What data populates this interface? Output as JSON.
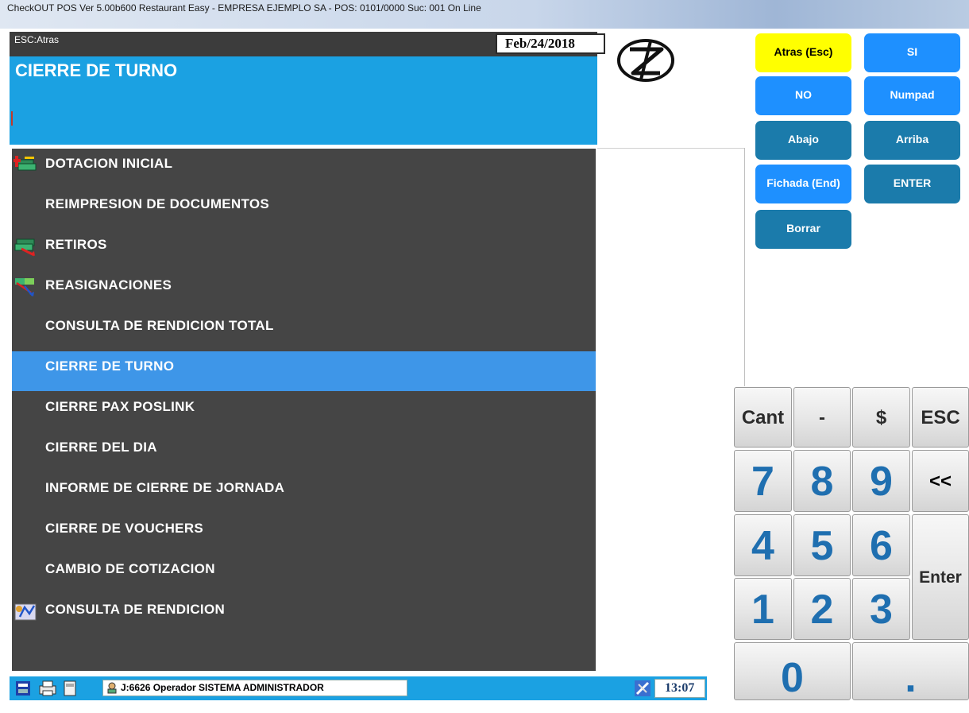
{
  "window": {
    "title": "CheckOUT POS Ver 5.00b600 Restaurant Easy - EMPRESA EJEMPLO SA - POS: 0101/0000 Suc: 001  On Line"
  },
  "header": {
    "esc_hint": "ESC:Atras",
    "date": "Feb/24/2018",
    "screen_title": "CIERRE DE TURNO"
  },
  "menu": {
    "items": [
      {
        "label": "DOTACION INICIAL",
        "icon": "cash-stack-icon"
      },
      {
        "label": "REIMPRESION DE DOCUMENTOS",
        "icon": ""
      },
      {
        "label": "RETIROS",
        "icon": "cash-withdraw-icon"
      },
      {
        "label": "REASIGNACIONES",
        "icon": "reassign-icon"
      },
      {
        "label": "CONSULTA DE RENDICION TOTAL",
        "icon": ""
      },
      {
        "label": "CIERRE DE TURNO",
        "icon": "",
        "selected": true
      },
      {
        "label": "CIERRE PAX POSLINK",
        "icon": ""
      },
      {
        "label": "CIERRE DEL DIA",
        "icon": ""
      },
      {
        "label": "INFORME DE CIERRE DE JORNADA",
        "icon": ""
      },
      {
        "label": "CIERRE DE VOUCHERS",
        "icon": ""
      },
      {
        "label": "CAMBIO DE COTIZACION",
        "icon": ""
      },
      {
        "label": "CONSULTA DE RENDICION",
        "icon": "report-icon"
      }
    ]
  },
  "actions": {
    "back": "Atras (Esc)",
    "yes": "SI",
    "no": "NO",
    "numpad": "Numpad",
    "down": "Abajo",
    "up": "Arriba",
    "clock_in": "Fichada (End)",
    "enter": "ENTER",
    "delete": "Borrar"
  },
  "keypad": {
    "cant": "Cant",
    "minus": "-",
    "dollar": "$",
    "esc": "ESC",
    "k7": "7",
    "k8": "8",
    "k9": "9",
    "backspace": "<<",
    "k4": "4",
    "k5": "5",
    "k6": "6",
    "enter": "Enter",
    "k1": "1",
    "k2": "2",
    "k3": "3",
    "k0": "0",
    "dot": "."
  },
  "status": {
    "operator": "J:6626 Operador  SISTEMA ADMINISTRADOR",
    "time": "13:07"
  },
  "colors": {
    "accent": "#1ba1e2",
    "menu_bg": "#454545",
    "selected": "#3e96e8",
    "yellow_button": "#ffff00",
    "blue_button": "#1e90ff",
    "teal_button": "#1b7bab",
    "digit": "#1f6fb0"
  }
}
